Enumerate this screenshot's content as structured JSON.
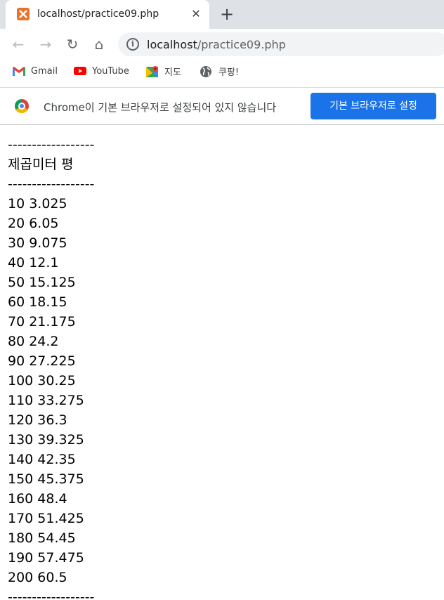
{
  "tab": {
    "title": "localhost/practice09.php",
    "close": "✕",
    "new_tab": "+"
  },
  "toolbar": {
    "back": "←",
    "forward": "→",
    "reload": "↻",
    "home": "⌂",
    "info": "i",
    "url_host": "localhost",
    "url_path": "/practice09.php"
  },
  "bookmarks": [
    {
      "label": "Gmail",
      "icon": "gmail-icon"
    },
    {
      "label": "YouTube",
      "icon": "youtube-icon"
    },
    {
      "label": "지도",
      "icon": "maps-icon"
    },
    {
      "label": "쿠팡!",
      "icon": "globe-icon"
    }
  ],
  "infobar": {
    "message": "Chrome이 기본 브라우저로 설정되어 있지 않습니다",
    "button": "기본 브라우저로 설정"
  },
  "page": {
    "separator": "------------------",
    "header": "제곱미터 평",
    "rows": [
      "10 3.025",
      "20 6.05",
      "30 9.075",
      "40 12.1",
      "50 15.125",
      "60 18.15",
      "70 21.175",
      "80 24.2",
      "90 27.225",
      "100 30.25",
      "110 33.275",
      "120 36.3",
      "130 39.325",
      "140 42.35",
      "150 45.375",
      "160 48.4",
      "170 51.425",
      "180 54.45",
      "190 57.475",
      "200 60.5"
    ]
  },
  "colors": {
    "accent": "#1a73e8",
    "tabstrip": "#dee1e6",
    "omnibox": "#f1f3f4"
  }
}
